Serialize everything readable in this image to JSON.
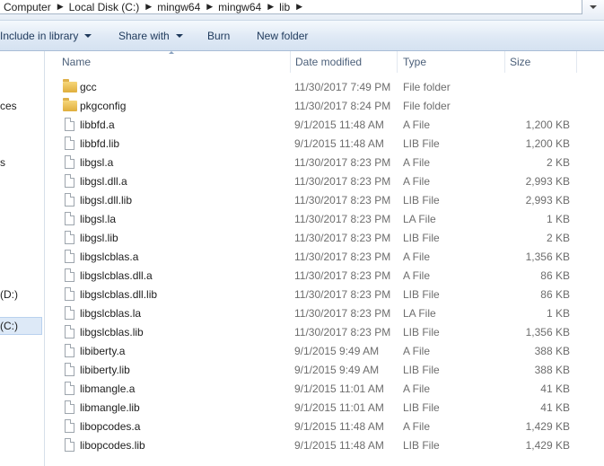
{
  "address": {
    "crumbs": [
      "Computer",
      "Local Disk (C:)",
      "mingw64",
      "mingw64",
      "lib"
    ]
  },
  "toolbar": {
    "include_label": "Include in library",
    "share_label": "Share with",
    "burn_label": "Burn",
    "new_folder_label": "New folder"
  },
  "nav": {
    "partial_items": [
      "ces",
      "s",
      "(C:)",
      "(D:)"
    ]
  },
  "columns": {
    "name": "Name",
    "date": "Date modified",
    "type": "Type",
    "size": "Size"
  },
  "files": [
    {
      "name": "gcc",
      "date": "11/30/2017 7:49 PM",
      "type": "File folder",
      "size": "",
      "icon": "folder-icon"
    },
    {
      "name": "pkgconfig",
      "date": "11/30/2017 8:24 PM",
      "type": "File folder",
      "size": "",
      "icon": "folder-icon"
    },
    {
      "name": "libbfd.a",
      "date": "9/1/2015 11:48 AM",
      "type": "A File",
      "size": "1,200 KB",
      "icon": "file-icon"
    },
    {
      "name": "libbfd.lib",
      "date": "9/1/2015 11:48 AM",
      "type": "LIB File",
      "size": "1,200 KB",
      "icon": "file-icon"
    },
    {
      "name": "libgsl.a",
      "date": "11/30/2017 8:23 PM",
      "type": "A File",
      "size": "2 KB",
      "icon": "file-icon"
    },
    {
      "name": "libgsl.dll.a",
      "date": "11/30/2017 8:23 PM",
      "type": "A File",
      "size": "2,993 KB",
      "icon": "file-icon"
    },
    {
      "name": "libgsl.dll.lib",
      "date": "11/30/2017 8:23 PM",
      "type": "LIB File",
      "size": "2,993 KB",
      "icon": "file-icon"
    },
    {
      "name": "libgsl.la",
      "date": "11/30/2017 8:23 PM",
      "type": "LA File",
      "size": "1 KB",
      "icon": "file-icon"
    },
    {
      "name": "libgsl.lib",
      "date": "11/30/2017 8:23 PM",
      "type": "LIB File",
      "size": "2 KB",
      "icon": "file-icon"
    },
    {
      "name": "libgslcblas.a",
      "date": "11/30/2017 8:23 PM",
      "type": "A File",
      "size": "1,356 KB",
      "icon": "file-icon"
    },
    {
      "name": "libgslcblas.dll.a",
      "date": "11/30/2017 8:23 PM",
      "type": "A File",
      "size": "86 KB",
      "icon": "file-icon"
    },
    {
      "name": "libgslcblas.dll.lib",
      "date": "11/30/2017 8:23 PM",
      "type": "LIB File",
      "size": "86 KB",
      "icon": "file-icon"
    },
    {
      "name": "libgslcblas.la",
      "date": "11/30/2017 8:23 PM",
      "type": "LA File",
      "size": "1 KB",
      "icon": "file-icon"
    },
    {
      "name": "libgslcblas.lib",
      "date": "11/30/2017 8:23 PM",
      "type": "LIB File",
      "size": "1,356 KB",
      "icon": "file-icon"
    },
    {
      "name": "libiberty.a",
      "date": "9/1/2015 9:49 AM",
      "type": "A File",
      "size": "388 KB",
      "icon": "file-icon"
    },
    {
      "name": "libiberty.lib",
      "date": "9/1/2015 9:49 AM",
      "type": "LIB File",
      "size": "388 KB",
      "icon": "file-icon"
    },
    {
      "name": "libmangle.a",
      "date": "9/1/2015 11:01 AM",
      "type": "A File",
      "size": "41 KB",
      "icon": "file-icon"
    },
    {
      "name": "libmangle.lib",
      "date": "9/1/2015 11:01 AM",
      "type": "LIB File",
      "size": "41 KB",
      "icon": "file-icon"
    },
    {
      "name": "libopcodes.a",
      "date": "9/1/2015 11:48 AM",
      "type": "A File",
      "size": "1,429 KB",
      "icon": "file-icon"
    },
    {
      "name": "libopcodes.lib",
      "date": "9/1/2015 11:48 AM",
      "type": "LIB File",
      "size": "1,429 KB",
      "icon": "file-icon"
    }
  ]
}
